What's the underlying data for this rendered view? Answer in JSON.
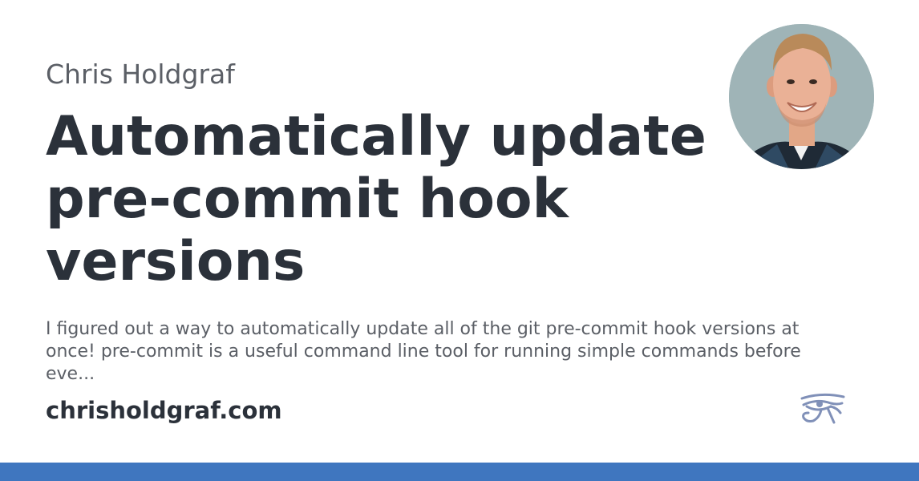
{
  "card": {
    "author": "Chris Holdgraf",
    "title": "Automatically update pre-commit hook versions",
    "description": "I figured out a way to automatically update all of the git pre-commit hook versions at once! pre-commit is a useful command line tool for running simple commands before eve...",
    "site": "chrisholdgraf.com"
  },
  "icons": {
    "avatar": "author-photo",
    "logo": "eye-of-horus-logo"
  },
  "colors": {
    "title": "#2b313a",
    "muted_text": "#5b5f66",
    "accent_bar": "#3f76bf",
    "logo": "#8090b8"
  }
}
